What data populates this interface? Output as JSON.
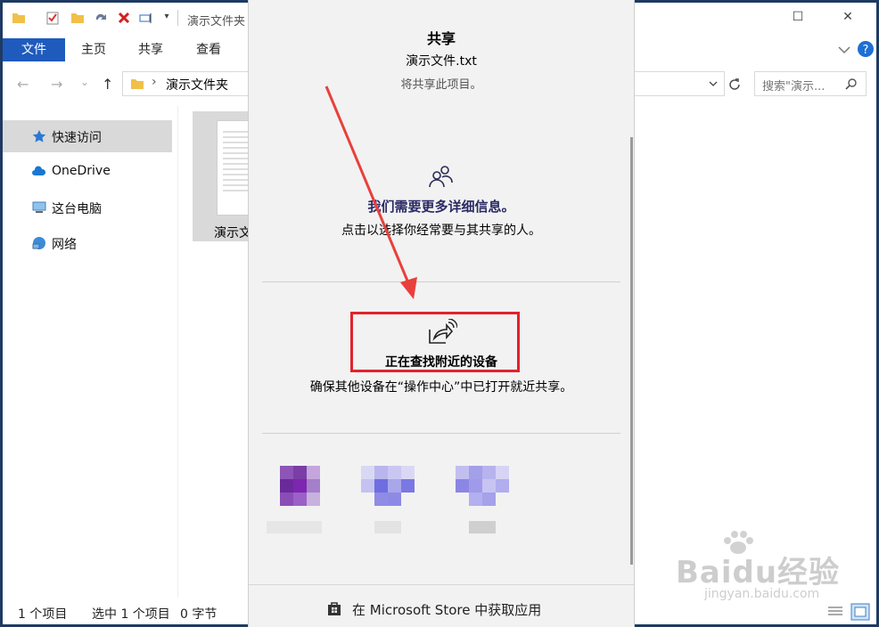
{
  "window": {
    "title": "演示文件夹",
    "ribbon_tabs": [
      "文件",
      "主页",
      "共享",
      "查看"
    ]
  },
  "address": {
    "path": "演示文件夹",
    "search_placeholder": "搜索\"演示...",
    "nav_arrows": [
      "←",
      "→",
      "⌄",
      "↑",
      "›"
    ]
  },
  "sidebar": {
    "items": [
      {
        "label": "快速访问",
        "icon": "star-icon",
        "selected": true
      },
      {
        "label": "OneDrive",
        "icon": "cloud-icon",
        "selected": false
      },
      {
        "label": "这台电脑",
        "icon": "computer-icon",
        "selected": false
      },
      {
        "label": "网络",
        "icon": "network-icon",
        "selected": false
      }
    ]
  },
  "file": {
    "name_partial": "演示文"
  },
  "statusbar": {
    "item_count": "1 个项目",
    "selected": "选中 1 个项目",
    "size": "0 字节"
  },
  "share_panel": {
    "title": "共享",
    "file_name": "演示文件.txt",
    "subtitle": "将共享此项目。",
    "people_heading": "我们需要更多详细信息。",
    "people_sub": "点击以选择你经常要与其共享的人。",
    "nearby_heading": "正在查找附近的设备",
    "nearby_sub": "确保其他设备在“操作中心”中已打开就近共享。",
    "store_link": "在 Microsoft Store 中获取应用"
  },
  "watermark": {
    "brand": "Baidu经验",
    "site": "jingyan.baidu.com"
  },
  "colors": {
    "accent": "#1e5bbd",
    "highlight_box": "#e2222b",
    "arrow": "#e8403c",
    "panel_bg": "#f2f2f2"
  }
}
